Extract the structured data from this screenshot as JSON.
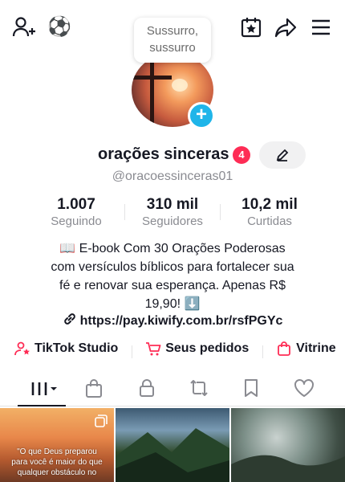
{
  "popup": {
    "line1": "Sussurro,",
    "line2": "sussurro"
  },
  "profile": {
    "username": "orações sinceras",
    "notification_count": "4",
    "handle": "@oracoessinceras01"
  },
  "stats": [
    {
      "value": "1.007",
      "label": "Seguindo"
    },
    {
      "value": "310 mil",
      "label": "Seguidores"
    },
    {
      "value": "10,2 mil",
      "label": "Curtidas"
    }
  ],
  "bio": {
    "line1": "📖 E-book Com 30 Orações Poderosas",
    "line2": "com versículos bíblicos para fortalecer sua",
    "line3": "fé e renovar sua esperança. Apenas R$",
    "line4": "19,90! ⬇️",
    "link": "https://pay.kiwify.com.br/rsfPGYc"
  },
  "shortcuts": [
    {
      "label": "TikTok Studio",
      "icon": "studio-icon"
    },
    {
      "label": "Seus pedidos",
      "icon": "cart-icon"
    },
    {
      "label": "Vitrine",
      "icon": "bag-icon"
    }
  ],
  "tabs": [
    "videos-grid-icon",
    "shop-bag-icon",
    "lock-icon",
    "repost-icon",
    "bookmark-icon",
    "heart-icon"
  ],
  "videos": {
    "first_caption": {
      "line1": "\"O que Deus preparou",
      "line2": "para você é maior do que",
      "line3": "qualquer obstáculo no"
    }
  },
  "colors": {
    "accent_red": "#fe2c55",
    "add_blue": "#1fb5e9",
    "text_dark": "#161823",
    "text_gray": "#8a8b91"
  },
  "icons": {
    "top_left": [
      "add-friend-icon",
      "soccer-ball-icon"
    ],
    "top_right": [
      "calendar-star-icon",
      "share-icon",
      "menu-icon"
    ]
  }
}
